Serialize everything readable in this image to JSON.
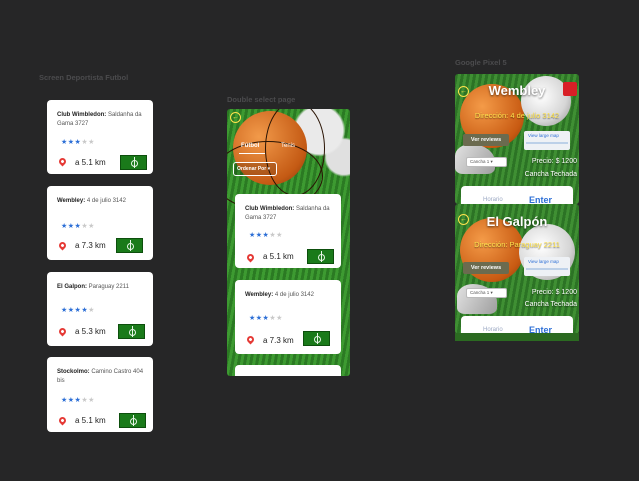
{
  "labels": {
    "frame1": "Screen Deportista Futbol",
    "frame2": "Double select page",
    "frame3": "Google Pixel 5"
  },
  "colors": {
    "canvas": "#262627",
    "accent_yellow": "#ffe34d",
    "star_blue": "#2d6fd6",
    "pin_red": "#e53935",
    "field_green": "#1a7a1a"
  },
  "list_cards": [
    {
      "name": "Club Wimbledon:",
      "address": " Saldanha da Gama 3727",
      "rating": 3,
      "distance": "a 5.1 km"
    },
    {
      "name": "Wembley:",
      "address": " 4 de julio 3142",
      "rating": 3,
      "distance": "a 7.3 km"
    },
    {
      "name": "El Galpon:",
      "address": " Paraguay 2211",
      "rating": 4.5,
      "distance": "a 5.3 km"
    },
    {
      "name": "Stockolmo:",
      "address": " Camino Castro 404 bis",
      "rating": 3,
      "distance": "a 5.1 km"
    }
  ],
  "double_select": {
    "tabs": [
      "Fútbol",
      "Tenis"
    ],
    "sort_label": "Ordenar Por",
    "sort_arrow": "▾",
    "cards": [
      {
        "name": "Club Wimbledon:",
        "address": " Saldanha da Gama 3727",
        "rating": 3,
        "distance": "a 5.1 km"
      },
      {
        "name": "Wembley:",
        "address": " 4 de julio 3142",
        "rating": 3,
        "distance": "a 7.3 km"
      }
    ]
  },
  "details": [
    {
      "title": "Wembley",
      "address": "Dirección: 4 de julio 3142",
      "reviews_label": "Ver reviews",
      "map_label": "View large map",
      "select_value": "Cancha 1",
      "price": "Precio: $ 1200",
      "court_type": "Cancha Techada",
      "bottom_left": "Horario",
      "bottom_right": "Enter"
    },
    {
      "title": "El Galpón",
      "address": "Dirección: Paraguay 2211",
      "reviews_label": "Ver reviews",
      "map_label": "View large map",
      "select_value": "Cancha 1",
      "price": "Precio: $ 1200",
      "court_type": "Cancha Techada",
      "bottom_left": "Horario",
      "bottom_right": "Enter"
    }
  ]
}
